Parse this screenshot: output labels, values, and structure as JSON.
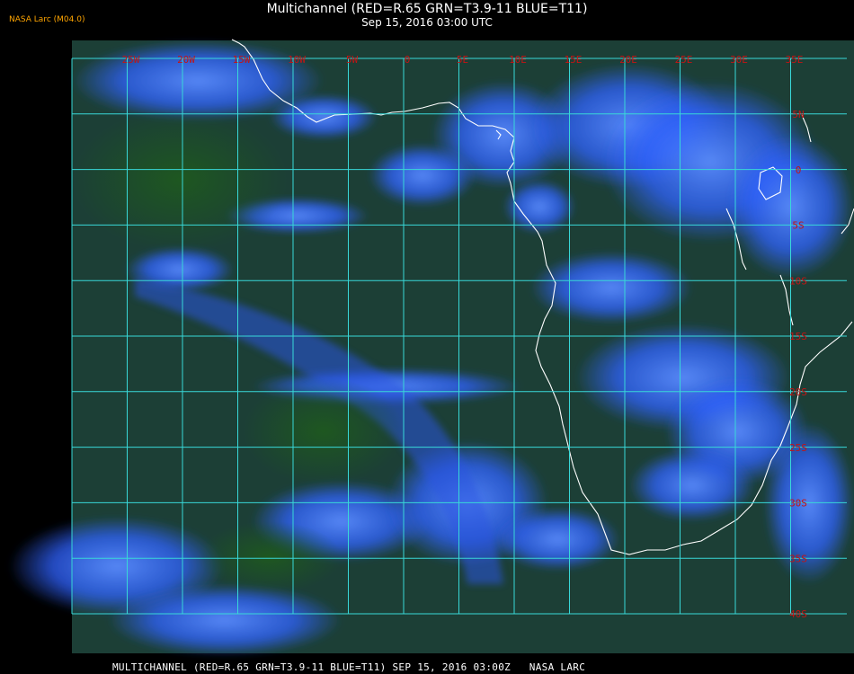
{
  "header": {
    "title": "Multichannel (RED=R.65 GRN=T3.9-11 BLUE=T11)",
    "datetime": "Sep 15, 2016 03:00 UTC",
    "credit": "NASA Larc (M04.0)"
  },
  "footer": {
    "text": "MULTICHANNEL (RED=R.65 GRN=T3.9-11 BLUE=T11) SEP 15, 2016 03:00Z   NASA LARC"
  },
  "map": {
    "lon_labels": [
      "25W",
      "20W",
      "15W",
      "10W",
      "5W",
      "0",
      "5E",
      "10E",
      "15E",
      "20E",
      "25E",
      "30E",
      "35E"
    ],
    "lat_labels": [
      "5N",
      "0",
      "5S",
      "10S",
      "15S",
      "20S",
      "25S",
      "30S",
      "35S",
      "40S"
    ],
    "colors": {
      "grid": "#38d8d8",
      "label": "#c41414",
      "coast": "#ffffff",
      "ocean": "#1f3d4a",
      "cloud": "#2f62ff"
    }
  }
}
